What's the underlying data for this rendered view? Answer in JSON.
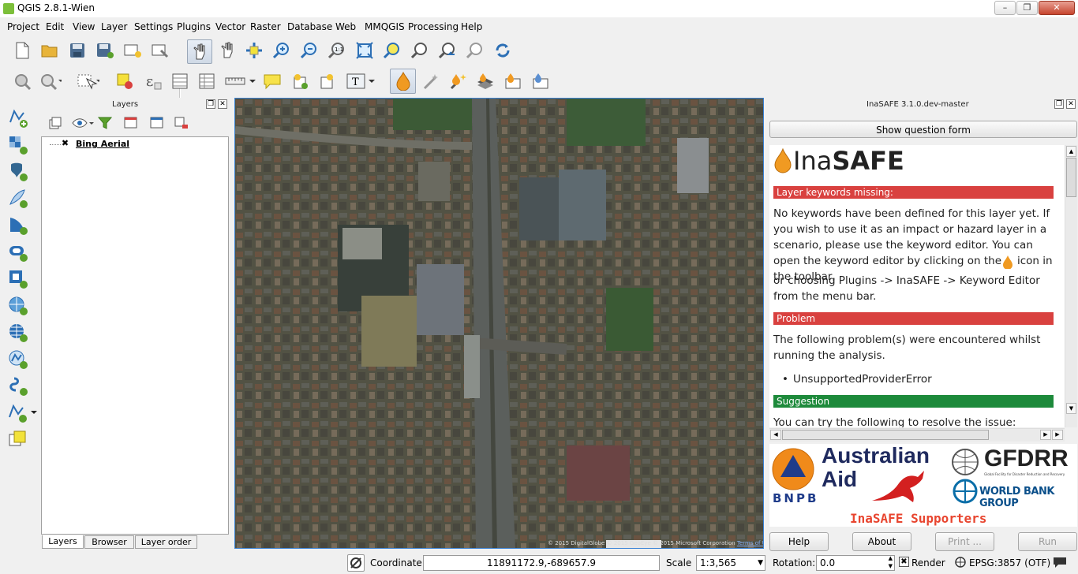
{
  "window": {
    "title": "QGIS 2.8.1-Wien"
  },
  "menu": [
    "Project",
    "Edit",
    "View",
    "Layer",
    "Settings",
    "Plugins",
    "Vector",
    "Raster",
    "Database",
    "Web",
    "MMQGIS",
    "Processing",
    "Help"
  ],
  "layers_panel": {
    "title": "Layers",
    "layer_name": "Bing Aerial",
    "tabs": [
      "Layers",
      "Browser",
      "Layer order"
    ]
  },
  "map": {
    "attribution": "© 2015 DigitalGlobe © 2015 GeoEye © 2015 Microsoft Corporation",
    "terms": "Terms of Use"
  },
  "inasafe": {
    "title": "InaSAFE 3.1.0.dev-master",
    "question_button": "Show question form",
    "logo_prefix": "Ina",
    "logo_bold": "SAFE",
    "keywords_header": "Layer keywords missing:",
    "keywords_text_1": "No keywords have been defined for this layer yet. If you wish to use it as an impact or hazard layer in a scenario, please use the keyword editor. You can open the keyword editor by clicking on the",
    "keywords_text_2": "icon in the toolbar,",
    "keywords_text_3": "or choosing Plugins -> InaSAFE -> Keyword Editor from the menu bar.",
    "problem_header": "Problem",
    "problem_text": "The following problem(s) were encountered whilst running the analysis.",
    "problem_item": "UnsupportedProviderError",
    "suggestion_header": "Suggestion",
    "suggestion_text": "You can try the following to resolve the issue:",
    "supporters": {
      "bnpb": "BNPB",
      "aus_aid_1": "Australian",
      "aus_aid_2": "Aid",
      "gfdrr": "GFDRR",
      "gfdrr_sub": "Global Facility for Disaster Reduction and Recovery",
      "world_bank": "WORLD BANK GROUP",
      "caption": "InaSAFE Supporters"
    },
    "buttons": {
      "help": "Help",
      "about": "About",
      "print": "Print ...",
      "run": "Run"
    },
    "colors": {
      "red": "#d9413f",
      "green": "#1d8a3b"
    }
  },
  "status": {
    "coordinate_label": "Coordinate:",
    "coordinate_value": "11891172.9,-689657.9",
    "scale_label": "Scale",
    "scale_value": "1:3,565",
    "rotation_label": "Rotation:",
    "rotation_value": "0.0",
    "render_label": "Render",
    "crs": "EPSG:3857 (OTF)"
  }
}
